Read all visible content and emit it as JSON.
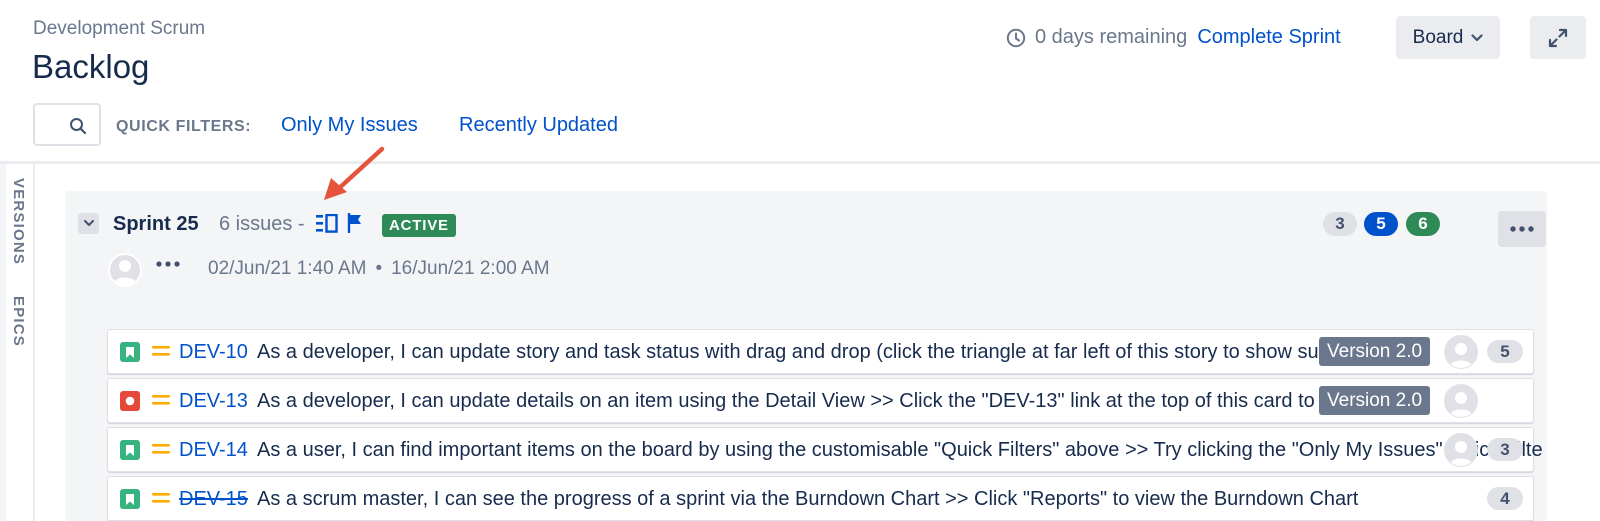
{
  "header": {
    "project_name": "Development Scrum",
    "title": "Backlog",
    "days_remaining": "0 days remaining",
    "complete_sprint": "Complete Sprint",
    "board_label": "Board",
    "icons": {
      "clock": "clock-icon",
      "dropdown": "chevron-down-icon",
      "expand": "expand-icon"
    }
  },
  "filters": {
    "search_placeholder": "",
    "quick_filters_label": "QUICK FILTERS:",
    "items": [
      "Only My Issues",
      "Recently Updated"
    ]
  },
  "sidebar": {
    "tabs": [
      "VERSIONS",
      "EPICS"
    ]
  },
  "sprint": {
    "name": "Sprint 25",
    "issue_count": "6 issues -",
    "status": "ACTIVE",
    "counts": {
      "todo": "3",
      "in_progress": "5",
      "done": "6"
    },
    "start": "02/Jun/21 1:40 AM",
    "separator": "•",
    "end": "16/Jun/21 2:00 AM",
    "colors": {
      "active": "#2e8b57",
      "in_progress": "#0052cc",
      "link": "#0052cc"
    }
  },
  "issues": [
    {
      "type": "story",
      "key": "DEV-10",
      "summary": "As a developer, I can update story and task status with drag and drop (click the triangle at far left of this story to show sub-tasks)",
      "version": "Version 2.0",
      "points": "5",
      "done": false
    },
    {
      "type": "bug",
      "key": "DEV-13",
      "summary": "As a developer, I can update details on an item using the Detail View >> Click the \"DEV-13\" link at the top of this card to open the detail view",
      "version": "Version 2.0",
      "points": "",
      "done": false
    },
    {
      "type": "story",
      "key": "DEV-14",
      "summary": "As a user, I can find important items on the board by using the customisable \"Quick Filters\" above >> Try clicking the \"Only My Issues\" Quick Filter above",
      "version": "",
      "points": "3",
      "done": false
    },
    {
      "type": "story",
      "key": "DEV-15",
      "summary": "As a scrum master, I can see the progress of a sprint via the Burndown Chart >> Click \"Reports\" to view the Burndown Chart",
      "version": "",
      "points": "4",
      "done": true
    }
  ]
}
